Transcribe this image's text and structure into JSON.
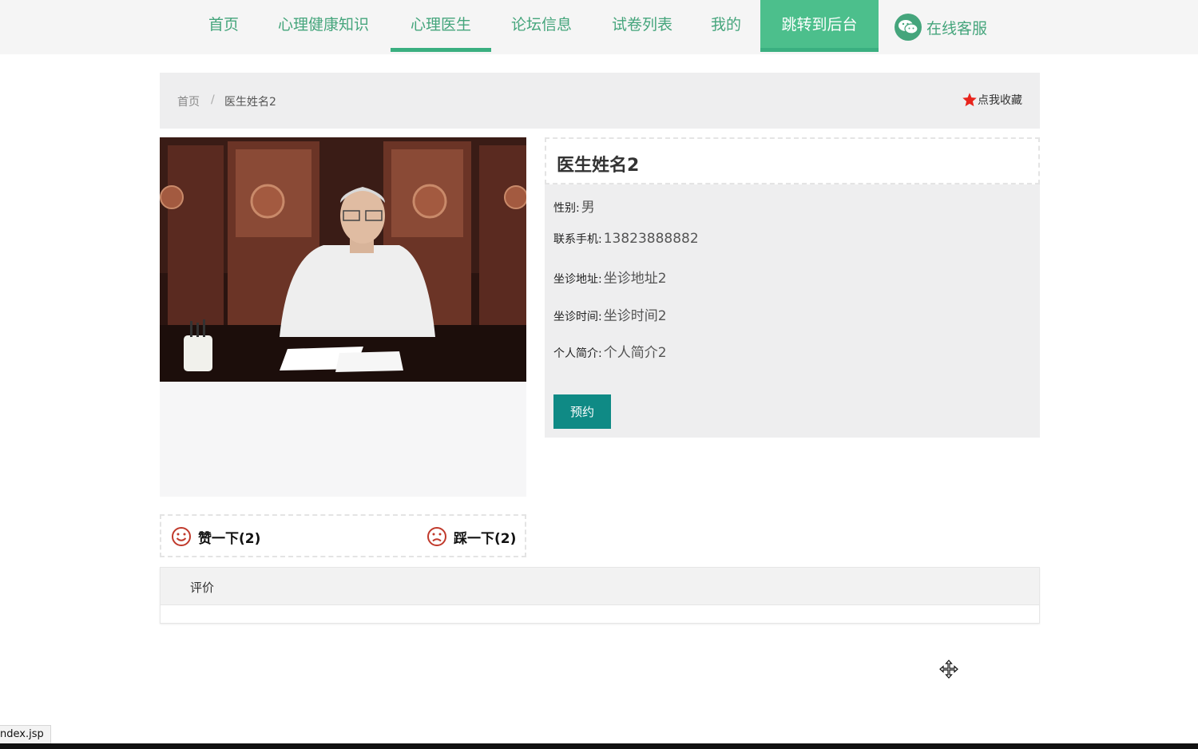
{
  "nav": {
    "items": [
      {
        "label": "首页"
      },
      {
        "label": "心理健康知识"
      },
      {
        "label": "心理医生"
      },
      {
        "label": "论坛信息"
      },
      {
        "label": "试卷列表"
      },
      {
        "label": "我的"
      },
      {
        "label": "跳转到后台"
      }
    ],
    "active_index": 2,
    "service_label": "在线客服",
    "service_icon": "wechat-icon",
    "accent_color": "#45a57c"
  },
  "breadcrumb": {
    "home": "首页",
    "separator": "/",
    "current": "医生姓名2",
    "collect_label": "点我收藏",
    "collect_icon": "star-icon"
  },
  "doctor": {
    "name": "医生姓名2",
    "fields": [
      {
        "label": "性别:",
        "value": "男"
      },
      {
        "label": "联系手机:",
        "value": "13823888882"
      },
      {
        "label": "坐诊地址:",
        "value": "坐诊地址2"
      },
      {
        "label": "坐诊时间:",
        "value": "坐诊时间2"
      },
      {
        "label": "个人简介:",
        "value": "个人简介2"
      }
    ],
    "book_label": "预约"
  },
  "votes": {
    "like_label": "赞一下(2)",
    "dislike_label": "踩一下(2)"
  },
  "review": {
    "title": "评价"
  },
  "status": {
    "url_text": "ndex.jsp"
  }
}
